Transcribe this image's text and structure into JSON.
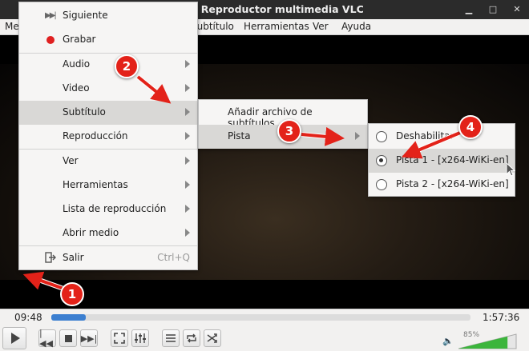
{
  "window": {
    "title": "mp4 - Reproductor multimedia VLC"
  },
  "menubar": {
    "medio_partial": "Me",
    "subtitulo_partial": "Subtítulo",
    "herramientas": "Herramientas",
    "ver": "Ver",
    "ayuda": "Ayuda"
  },
  "context_menu": {
    "siguiente": "Siguiente",
    "grabar": "Grabar",
    "audio": "Audio",
    "video": "Video",
    "subtitulo": "Subtítulo",
    "reproduccion": "Reproducción",
    "ver": "Ver",
    "herramientas": "Herramientas",
    "lista": "Lista de reproducción",
    "abrir": "Abrir medio",
    "salir": "Salir",
    "salir_shortcut": "Ctrl+Q"
  },
  "subtitle_menu": {
    "add_file": "Añadir archivo de subtítulos...",
    "pista": "Pista"
  },
  "track_menu": {
    "items": [
      {
        "label": "Deshabilitar",
        "checked": false
      },
      {
        "label": "Pista 1 - [x264-WiKi-en]",
        "checked": true
      },
      {
        "label": "Pista 2 - [x264-WiKi-en]",
        "checked": false
      }
    ]
  },
  "annotations": {
    "b1": "1",
    "b2": "2",
    "b3": "3",
    "b4": "4",
    "color": "#e32219"
  },
  "controls": {
    "elapsed": "09:48",
    "total": "1:57:36",
    "progress": 0.083,
    "volume_label": "85%",
    "volume": 0.85
  },
  "icons": [
    "play-icon",
    "previous-icon",
    "stop-icon",
    "next-icon",
    "fullscreen-icon",
    "extended-settings-icon",
    "playlist-icon",
    "loop-icon",
    "shuffle-icon",
    "speaker-icon",
    "record-icon",
    "exit-icon",
    "submenu-arrow-icon"
  ]
}
